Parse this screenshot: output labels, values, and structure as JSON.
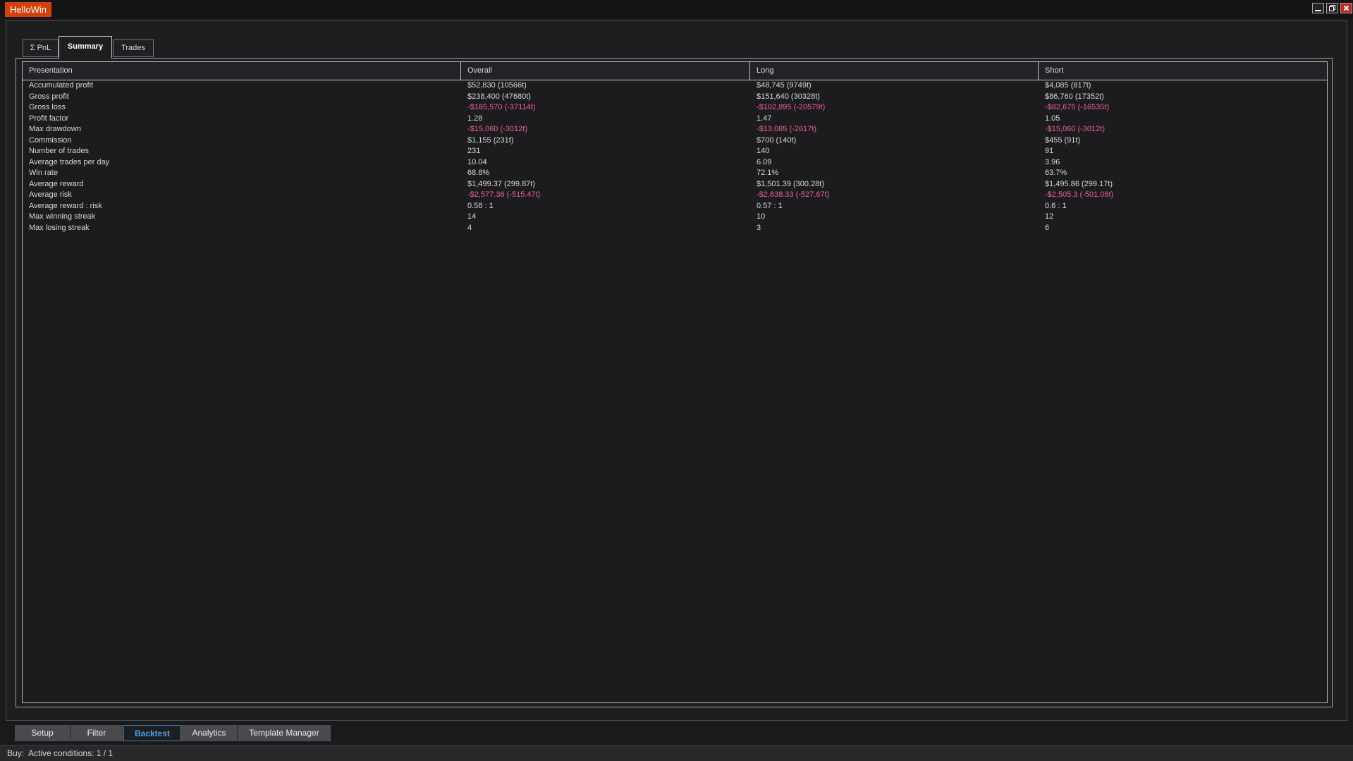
{
  "window": {
    "title": "HelloWin",
    "controls": [
      {
        "name": "minimize"
      },
      {
        "name": "restore"
      },
      {
        "name": "close"
      }
    ]
  },
  "top_tabs": [
    {
      "label": "Σ PnL",
      "active": false
    },
    {
      "label": "Summary",
      "active": true
    },
    {
      "label": "Trades",
      "active": false
    }
  ],
  "summary_table": {
    "columns": [
      "Presentation",
      "Overall",
      "Long",
      "Short"
    ],
    "rows": [
      {
        "label": "Accumulated profit",
        "overall": "$52,830 (10566t)",
        "long": "$48,745 (9749t)",
        "short": "$4,085 (817t)",
        "negative": false
      },
      {
        "label": "Gross profit",
        "overall": "$238,400 (47680t)",
        "long": "$151,640 (30328t)",
        "short": "$86,760 (17352t)",
        "negative": false
      },
      {
        "label": "Gross loss",
        "overall": "-$185,570 (-37114t)",
        "long": "-$102,895 (-20579t)",
        "short": "-$82,675 (-16535t)",
        "negative": true
      },
      {
        "label": "Profit factor",
        "overall": "1.28",
        "long": "1.47",
        "short": "1.05",
        "negative": false
      },
      {
        "label": "Max drawdown",
        "overall": "-$15,060 (-3012t)",
        "long": "-$13,085 (-2617t)",
        "short": "-$15,060 (-3012t)",
        "negative": true
      },
      {
        "label": "Commission",
        "overall": "$1,155 (231t)",
        "long": "$700 (140t)",
        "short": "$455 (91t)",
        "negative": false
      },
      {
        "label": "Number of trades",
        "overall": "231",
        "long": "140",
        "short": "91",
        "negative": false
      },
      {
        "label": "Average trades per day",
        "overall": "10.04",
        "long": "6.09",
        "short": "3.96",
        "negative": false
      },
      {
        "label": "Win rate",
        "overall": "68.8%",
        "long": "72.1%",
        "short": "63.7%",
        "negative": false
      },
      {
        "label": "Average reward",
        "overall": "$1,499.37 (299.87t)",
        "long": "$1,501.39 (300.28t)",
        "short": "$1,495.86 (299.17t)",
        "negative": false
      },
      {
        "label": "Average risk",
        "overall": "-$2,577.36 (-515.47t)",
        "long": "-$2,638.33 (-527.67t)",
        "short": "-$2,505.3 (-501.06t)",
        "negative": true
      },
      {
        "label": "Average reward : risk",
        "overall": "0.58 : 1",
        "long": "0.57 : 1",
        "short": "0.6 : 1",
        "negative": false
      },
      {
        "label": "Max winning streak",
        "overall": "14",
        "long": "10",
        "short": "12",
        "negative": false
      },
      {
        "label": "Max losing streak",
        "overall": "4",
        "long": "3",
        "short": "6",
        "negative": false
      }
    ]
  },
  "bottom_tabs": [
    {
      "label": "Setup",
      "active": false
    },
    {
      "label": "Filter",
      "active": false
    },
    {
      "label": "Backtest",
      "active": true
    },
    {
      "label": "Analytics",
      "active": false
    },
    {
      "label": "Template Manager",
      "active": false
    }
  ],
  "status_bar": {
    "text": "Buy:  Active conditions: 1 / 1"
  },
  "colors": {
    "title_accent": "#d2400e",
    "negative_value_pink": "#ed5f9d",
    "active_tab_blue": "#4aa0e8",
    "close_button_red": "#c1261b"
  }
}
